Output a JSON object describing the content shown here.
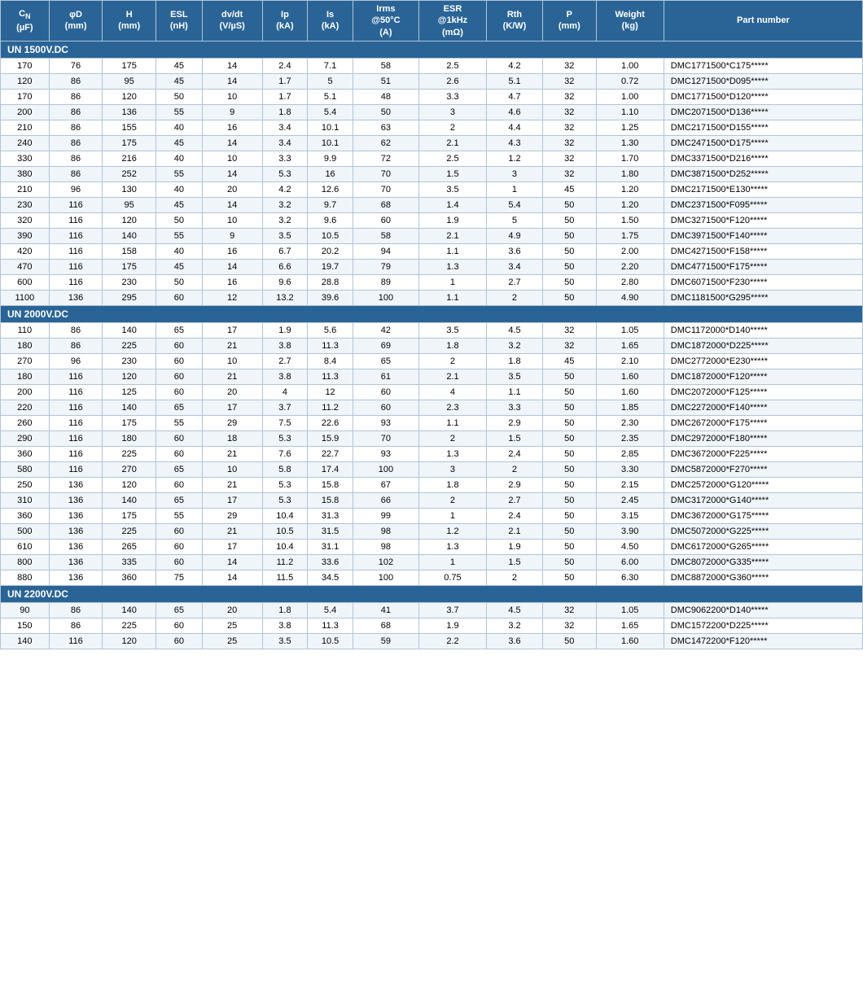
{
  "headers": [
    {
      "id": "cn",
      "line1": "C",
      "sub": "N",
      "line2": "(µF)"
    },
    {
      "id": "phid",
      "line1": "φD",
      "line2": "(mm)"
    },
    {
      "id": "h",
      "line1": "H",
      "line2": "(mm)"
    },
    {
      "id": "esl",
      "line1": "ESL",
      "line2": "(nH)"
    },
    {
      "id": "dvdt",
      "line1": "dv/dt",
      "line2": "(V/µS)"
    },
    {
      "id": "ip",
      "line1": "Ip",
      "line2": "(kA)"
    },
    {
      "id": "is",
      "line1": "Is",
      "line2": "(kA)"
    },
    {
      "id": "irms",
      "line1": "Irms",
      "line2": "@50°C",
      "line3": "(A)"
    },
    {
      "id": "esr",
      "line1": "ESR",
      "line2": "@1kHz",
      "line3": "(mΩ)"
    },
    {
      "id": "rth",
      "line1": "Rth",
      "line2": "(K/W)"
    },
    {
      "id": "p",
      "line1": "P",
      "line2": "(mm)"
    },
    {
      "id": "weight",
      "line1": "Weight",
      "line2": "(kg)"
    },
    {
      "id": "partnum",
      "line1": "Part number"
    }
  ],
  "sections": [
    {
      "title": "UN 1500V.DC",
      "rows": [
        [
          170,
          76,
          175,
          45,
          14,
          2.4,
          7.1,
          58,
          2.5,
          4.2,
          32,
          "1.00",
          "DMC1771500*C175*****"
        ],
        [
          120,
          86,
          95,
          45,
          14,
          1.7,
          5.0,
          51,
          2.6,
          5.1,
          32,
          "0.72",
          "DMC1271500*D095*****"
        ],
        [
          170,
          86,
          120,
          50,
          10,
          1.7,
          5.1,
          48,
          3.3,
          4.7,
          32,
          "1.00",
          "DMC1771500*D120*****"
        ],
        [
          200,
          86,
          136,
          55,
          9,
          1.8,
          5.4,
          50,
          3.0,
          4.6,
          32,
          "1.10",
          "DMC2071500*D136*****"
        ],
        [
          210,
          86,
          155,
          40,
          16,
          3.4,
          10.1,
          63,
          2.0,
          4.4,
          32,
          "1.25",
          "DMC2171500*D155*****"
        ],
        [
          240,
          86,
          175,
          45,
          14,
          3.4,
          10.1,
          62,
          2.1,
          4.3,
          32,
          "1.30",
          "DMC2471500*D175*****"
        ],
        [
          330,
          86,
          216,
          40,
          10,
          3.3,
          9.9,
          72,
          2.5,
          1.2,
          32,
          "1.70",
          "DMC3371500*D216*****"
        ],
        [
          380,
          86,
          252,
          55,
          14,
          5.3,
          16.0,
          70,
          1.5,
          3.0,
          32,
          "1.80",
          "DMC3871500*D252*****"
        ],
        [
          210,
          96,
          130,
          40,
          20,
          4.2,
          12.6,
          70,
          3.5,
          1.0,
          45,
          "1.20",
          "DMC2171500*E130*****"
        ],
        [
          230,
          116,
          95,
          45,
          14,
          3.2,
          9.7,
          68,
          1.4,
          5.4,
          50,
          "1.20",
          "DMC2371500*F095*****"
        ],
        [
          320,
          116,
          120,
          50,
          10,
          3.2,
          9.6,
          60,
          1.9,
          5.0,
          50,
          "1.50",
          "DMC3271500*F120*****"
        ],
        [
          390,
          116,
          140,
          55,
          9,
          3.5,
          10.5,
          58,
          2.1,
          4.9,
          50,
          "1.75",
          "DMC3971500*F140*****"
        ],
        [
          420,
          116,
          158,
          40,
          16,
          6.7,
          20.2,
          94,
          1.1,
          3.6,
          50,
          "2.00",
          "DMC4271500*F158*****"
        ],
        [
          470,
          116,
          175,
          45,
          14,
          6.6,
          19.7,
          79,
          1.3,
          3.4,
          50,
          "2.20",
          "DMC4771500*F175*****"
        ],
        [
          600,
          116,
          230,
          50,
          16,
          9.6,
          28.8,
          89,
          1.0,
          2.7,
          50,
          "2.80",
          "DMC6071500*F230*****"
        ],
        [
          1100,
          136,
          295,
          60,
          12,
          13.2,
          39.6,
          100,
          1.1,
          2.0,
          50,
          "4.90",
          "DMC1181500*G295*****"
        ]
      ]
    },
    {
      "title": "UN 2000V.DC",
      "rows": [
        [
          110,
          86,
          140,
          65,
          17,
          1.9,
          5.6,
          42,
          3.5,
          4.5,
          32,
          "1.05",
          "DMC1172000*D140*****"
        ],
        [
          180,
          86,
          225,
          60,
          21,
          3.8,
          11.3,
          69,
          1.8,
          3.2,
          32,
          "1.65",
          "DMC1872000*D225*****"
        ],
        [
          270,
          96,
          230,
          60,
          10,
          2.7,
          8.4,
          65,
          2.0,
          1.8,
          45,
          "2.10",
          "DMC2772000*E230*****"
        ],
        [
          180,
          116,
          120,
          60,
          21,
          3.8,
          11.3,
          61,
          2.1,
          3.5,
          50,
          "1.60",
          "DMC1872000*F120*****"
        ],
        [
          200,
          116,
          125,
          60,
          20,
          4,
          12,
          60,
          4,
          1.1,
          50,
          "1.60",
          "DMC2072000*F125*****"
        ],
        [
          220,
          116,
          140,
          65,
          17,
          3.7,
          11.2,
          60,
          2.3,
          3.3,
          50,
          "1.85",
          "DMC2272000*F140*****"
        ],
        [
          260,
          116,
          175,
          55,
          29,
          7.5,
          22.6,
          93,
          1.1,
          2.9,
          50,
          "2.30",
          "DMC2672000*F175*****"
        ],
        [
          290,
          116,
          180,
          60,
          18,
          5.3,
          15.9,
          70,
          2,
          1.5,
          50,
          "2.35",
          "DMC2972000*F180*****"
        ],
        [
          360,
          116,
          225,
          60,
          21,
          7.6,
          22.7,
          93,
          1.3,
          2.4,
          50,
          "2.85",
          "DMC3672000*F225*****"
        ],
        [
          580,
          116,
          270,
          65,
          10,
          5.8,
          17.4,
          100,
          3,
          2.0,
          50,
          "3.30",
          "DMC5872000*F270*****"
        ],
        [
          250,
          136,
          120,
          60,
          21,
          5.3,
          15.8,
          67,
          1.8,
          2.9,
          50,
          "2.15",
          "DMC2572000*G120*****"
        ],
        [
          310,
          136,
          140,
          65,
          17,
          5.3,
          15.8,
          66,
          2.0,
          2.7,
          50,
          "2.45",
          "DMC3172000*G140*****"
        ],
        [
          360,
          136,
          175,
          55,
          29,
          10.4,
          31.3,
          99,
          1.0,
          2.4,
          50,
          "3.15",
          "DMC3672000*G175*****"
        ],
        [
          500,
          136,
          225,
          60,
          21,
          10.5,
          31.5,
          98,
          1.2,
          2.1,
          50,
          "3.90",
          "DMC5072000*G225*****"
        ],
        [
          610,
          136,
          265,
          60,
          17,
          10.4,
          31.1,
          98,
          1.3,
          1.9,
          50,
          "4.50",
          "DMC6172000*G265*****"
        ],
        [
          800,
          136,
          335,
          60,
          14,
          11.2,
          33.6,
          102,
          1.0,
          1.5,
          50,
          "6.00",
          "DMC8072000*G335*****"
        ],
        [
          880,
          136,
          360,
          75,
          14,
          11.5,
          34.5,
          100,
          0.75,
          2,
          50,
          "6.30",
          "DMC8872000*G360*****"
        ]
      ]
    },
    {
      "title": "UN 2200V.DC",
      "rows": [
        [
          90,
          86,
          140,
          65,
          20,
          1.8,
          5.4,
          41,
          3.7,
          4.5,
          32,
          "1.05",
          "DMC9062200*D140*****"
        ],
        [
          150,
          86,
          225,
          60,
          25,
          3.8,
          11.3,
          68,
          1.9,
          3.2,
          32,
          "1.65",
          "DMC1572200*D225*****"
        ],
        [
          140,
          116,
          120,
          60,
          25,
          3.5,
          10.5,
          59,
          2.2,
          3.6,
          50,
          "1.60",
          "DMC1472200*F120*****"
        ]
      ]
    }
  ]
}
